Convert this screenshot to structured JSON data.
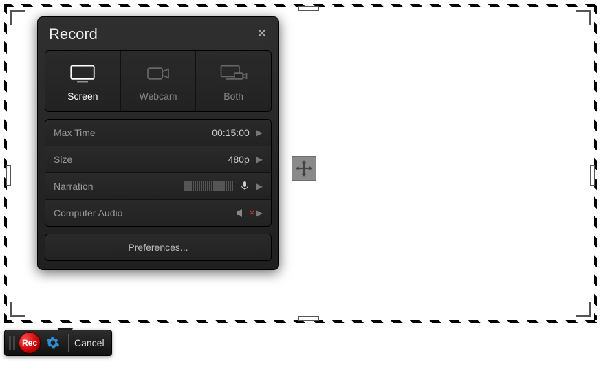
{
  "panel": {
    "title": "Record",
    "modes": {
      "screen": "Screen",
      "webcam": "Webcam",
      "both": "Both"
    },
    "rows": {
      "maxtime": {
        "label": "Max Time",
        "value": "00:15:00"
      },
      "size": {
        "label": "Size",
        "value": "480p"
      },
      "narration": {
        "label": "Narration"
      },
      "compaudio": {
        "label": "Computer Audio"
      }
    },
    "prefs": "Preferences..."
  },
  "toolbar": {
    "rec": "Rec",
    "cancel": "Cancel"
  }
}
